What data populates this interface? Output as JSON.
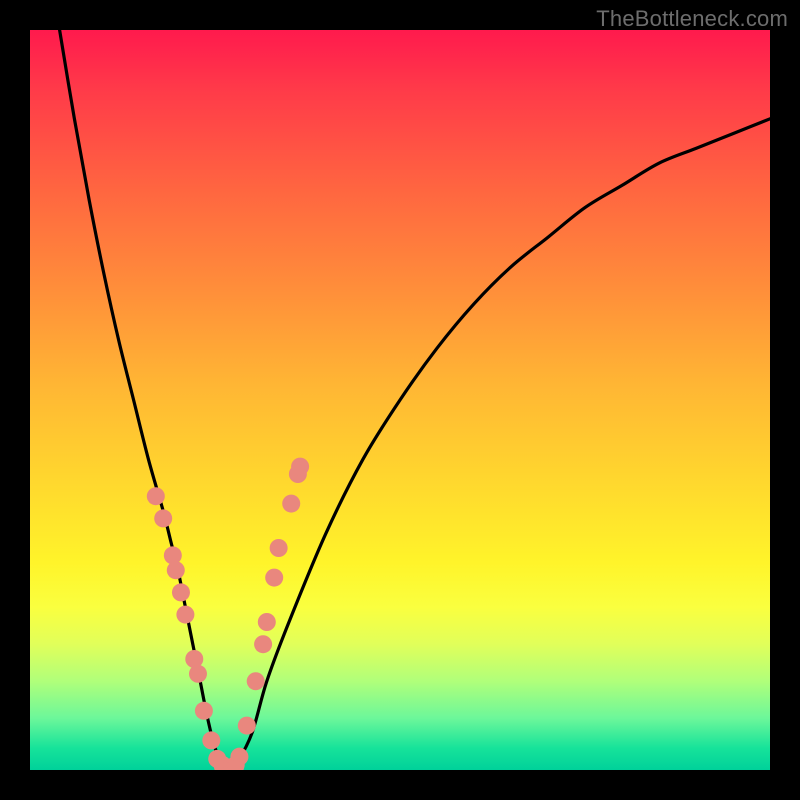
{
  "watermark": "TheBottleneck.com",
  "colors": {
    "frame": "#000000",
    "curve": "#000000",
    "dots": "#e9877e"
  },
  "chart_data": {
    "type": "line",
    "title": "",
    "xlabel": "",
    "ylabel": "",
    "ylim": [
      0,
      100
    ],
    "xlim": [
      0,
      100
    ],
    "series": [
      {
        "name": "bottleneck-curve",
        "x": [
          4,
          6,
          8,
          10,
          12,
          14,
          16,
          18,
          19,
          20,
          21,
          22,
          23,
          24,
          25,
          26,
          27,
          28,
          30,
          32,
          35,
          40,
          45,
          50,
          55,
          60,
          65,
          70,
          75,
          80,
          85,
          90,
          95,
          100
        ],
        "values": [
          100,
          88,
          77,
          67,
          58,
          50,
          42,
          35,
          31,
          27,
          22,
          17,
          12,
          7,
          3,
          1,
          0,
          1,
          5,
          12,
          20,
          32,
          42,
          50,
          57,
          63,
          68,
          72,
          76,
          79,
          82,
          84,
          86,
          88
        ]
      }
    ],
    "markers_left": {
      "name": "left-branch-dots",
      "x": [
        17.0,
        18.0,
        19.3,
        19.7,
        20.4,
        21.0,
        22.2,
        22.7,
        23.5,
        24.5,
        25.3,
        26.0
      ],
      "y": [
        37,
        34,
        29,
        27,
        24,
        21,
        15,
        13,
        8,
        4,
        1.5,
        0.7
      ]
    },
    "markers_right": {
      "name": "right-branch-dots",
      "x": [
        27.8,
        28.3,
        29.3,
        30.5,
        31.5,
        32.0,
        33.0,
        33.6,
        35.3,
        36.2,
        36.5
      ],
      "y": [
        0.7,
        1.8,
        6,
        12,
        17,
        20,
        26,
        30,
        36,
        40,
        41
      ]
    },
    "markers_valley": {
      "name": "valley-dots",
      "x": [
        26.0,
        26.6,
        27.2,
        27.8
      ],
      "y": [
        0.2,
        0.0,
        0.0,
        0.2
      ]
    }
  }
}
